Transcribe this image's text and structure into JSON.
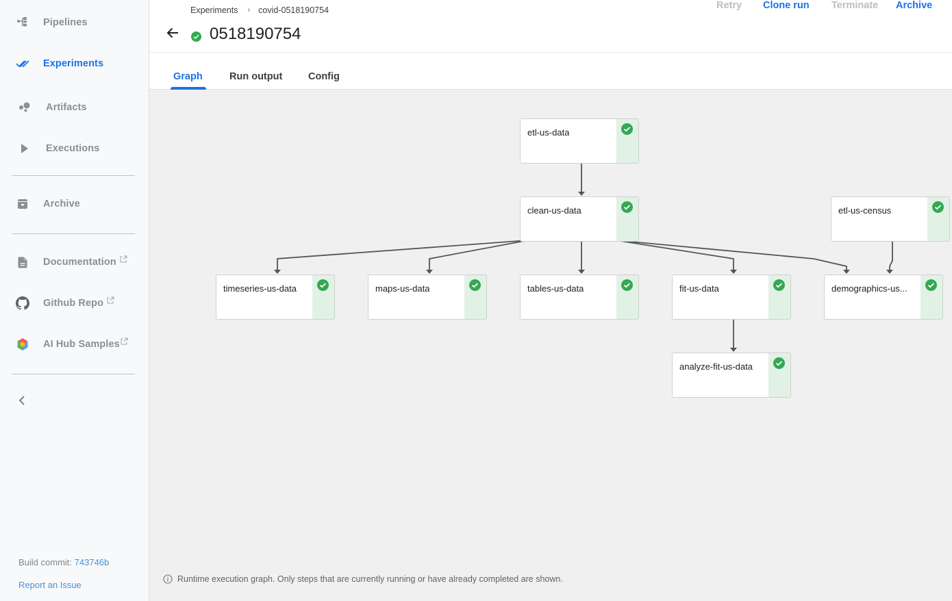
{
  "sidebar": {
    "items": [
      {
        "label": "Pipelines",
        "icon": "pipelines-icon",
        "active": false
      },
      {
        "label": "Experiments",
        "icon": "experiments-icon",
        "active": true
      },
      {
        "label": "Artifacts",
        "icon": "artifacts-icon",
        "active": false
      },
      {
        "label": "Executions",
        "icon": "executions-icon",
        "active": false
      },
      {
        "label": "Archive",
        "icon": "archive-icon",
        "active": false
      },
      {
        "label": "Documentation",
        "icon": "document-icon",
        "external": true
      },
      {
        "label": "Github Repo",
        "icon": "github-icon",
        "external": true
      },
      {
        "label": "AI Hub Samples",
        "icon": "ai-hub-icon",
        "external": true
      }
    ],
    "build_label": "Build commit:",
    "build_commit": "743746b",
    "report_issue": "Report an Issue"
  },
  "header": {
    "breadcrumb": [
      "Experiments",
      "covid-0518190754"
    ],
    "run_title": "0518190754",
    "run_status": "succeeded",
    "actions": [
      {
        "label": "Retry",
        "enabled": false
      },
      {
        "label": "Clone run",
        "enabled": true
      },
      {
        "label": "Terminate",
        "enabled": false
      },
      {
        "label": "Archive",
        "enabled": true
      }
    ]
  },
  "tabs": [
    {
      "label": "Graph",
      "active": true
    },
    {
      "label": "Run output",
      "active": false
    },
    {
      "label": "Config",
      "active": false
    }
  ],
  "graph": {
    "nodes": [
      {
        "id": "etl-us-data",
        "label": "etl-us-data",
        "status": "succeeded"
      },
      {
        "id": "clean-us-data",
        "label": "clean-us-data",
        "status": "succeeded"
      },
      {
        "id": "etl-us-census",
        "label": "etl-us-census",
        "status": "succeeded"
      },
      {
        "id": "timeseries-us-data",
        "label": "timeseries-us-data",
        "status": "succeeded"
      },
      {
        "id": "maps-us-data",
        "label": "maps-us-data",
        "status": "succeeded"
      },
      {
        "id": "tables-us-data",
        "label": "tables-us-data",
        "status": "succeeded"
      },
      {
        "id": "fit-us-data",
        "label": "fit-us-data",
        "status": "succeeded"
      },
      {
        "id": "demographics-us-data",
        "label": "demographics-us...",
        "status": "succeeded"
      },
      {
        "id": "analyze-fit-us-data",
        "label": "analyze-fit-us-data",
        "status": "succeeded"
      }
    ],
    "edges": [
      [
        "etl-us-data",
        "clean-us-data"
      ],
      [
        "clean-us-data",
        "timeseries-us-data"
      ],
      [
        "clean-us-data",
        "maps-us-data"
      ],
      [
        "clean-us-data",
        "tables-us-data"
      ],
      [
        "clean-us-data",
        "fit-us-data"
      ],
      [
        "clean-us-data",
        "demographics-us-data"
      ],
      [
        "etl-us-census",
        "demographics-us-data"
      ],
      [
        "fit-us-data",
        "analyze-fit-us-data"
      ]
    ],
    "info_text": "Runtime execution graph. Only steps that are currently running or have already completed are shown."
  },
  "colors": {
    "accent": "#1a73e8",
    "success": "#34a853",
    "success_strip": "#e2f1e5",
    "edge": "#50555a",
    "canvas_bg": "#f0f0f0"
  }
}
